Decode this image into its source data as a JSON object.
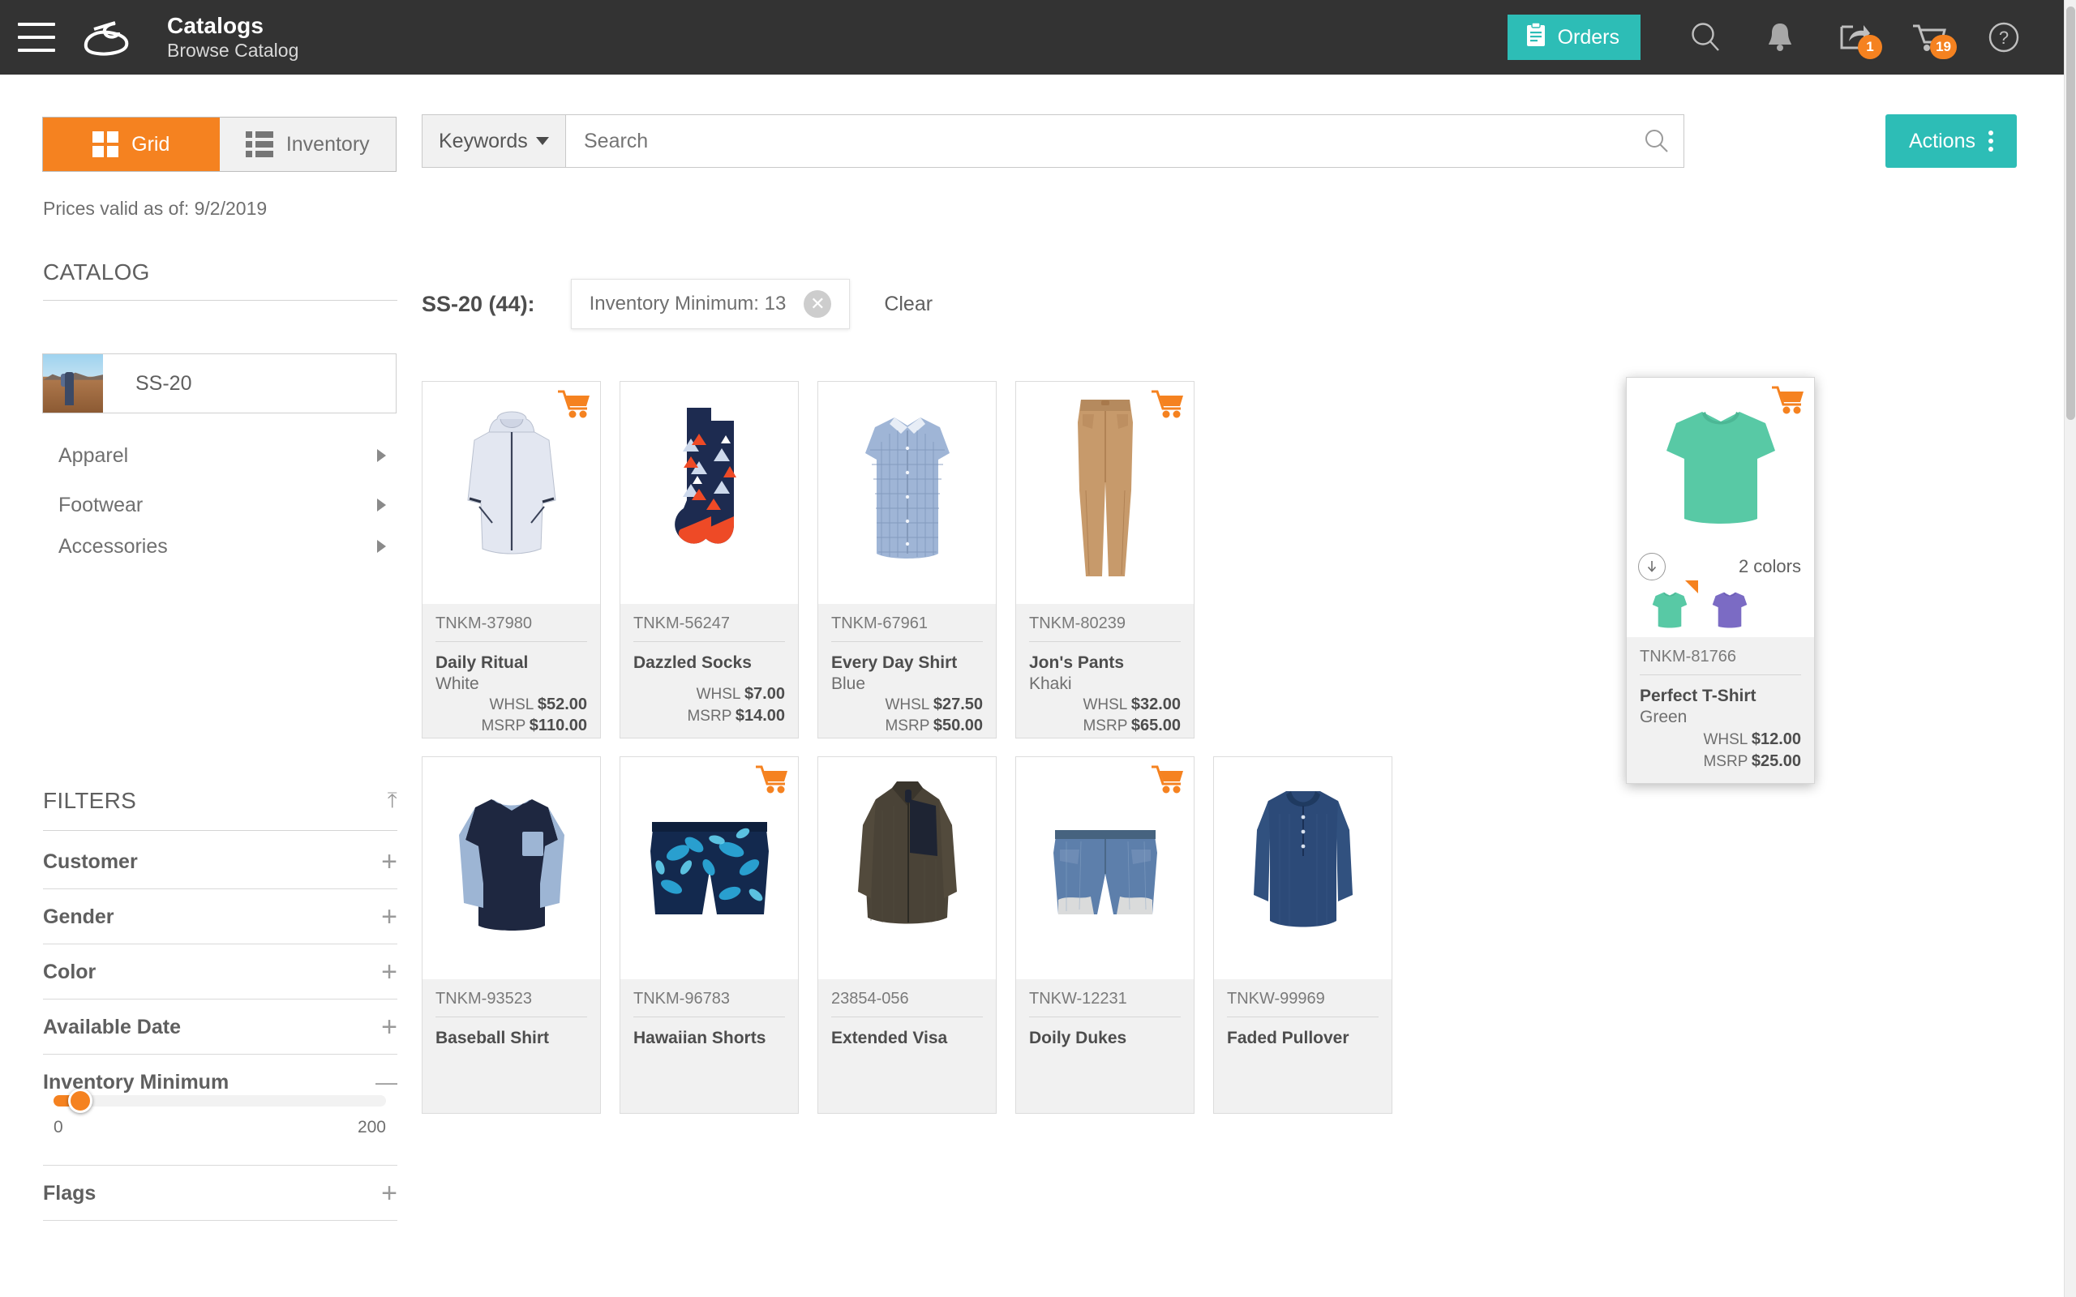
{
  "header": {
    "title": "Catalogs",
    "subtitle": "Browse Catalog",
    "orders_label": "Orders",
    "menu_icon": "hamburger-icon",
    "logo_icon": "brand-logo-icon",
    "search_icon": "search-icon",
    "bell_icon": "notifications-icon",
    "share_icon": "share-icon",
    "cart_icon": "cart-icon",
    "help_icon": "help-icon",
    "share_badge": "1",
    "cart_badge": "19",
    "bar_color": "#333333",
    "accent_teal": "#2dbdb6",
    "accent_orange": "#f58220"
  },
  "sidebar": {
    "view_toggle": {
      "grid_label": "Grid",
      "inventory_label": "Inventory",
      "active": "Grid"
    },
    "prices_valid": "Prices valid as of: 9/2/2019",
    "catalog_heading": "CATALOG",
    "catalog_selected": "SS-20",
    "tree": [
      {
        "label": "Apparel"
      },
      {
        "label": "Footwear"
      },
      {
        "label": "Accessories"
      }
    ],
    "filters_heading": "FILTERS",
    "filters": [
      {
        "label": "Customer",
        "state": "+"
      },
      {
        "label": "Gender",
        "state": "+"
      },
      {
        "label": "Color",
        "state": "+"
      },
      {
        "label": "Available Date",
        "state": "+"
      },
      {
        "label": "Inventory Minimum",
        "state": "—"
      },
      {
        "label": "Flags",
        "state": "+"
      }
    ],
    "slider": {
      "min_label": "0",
      "max_label": "200",
      "value": 13
    }
  },
  "search": {
    "scope_label": "Keywords",
    "placeholder": "Search",
    "value": "",
    "actions_label": "Actions"
  },
  "results": {
    "count_label": "SS-20 (44):",
    "chip_label": "Inventory Minimum: 13",
    "clear_label": "Clear"
  },
  "products": [
    {
      "sku": "TNKM-37980",
      "name": "Daily Ritual",
      "color": "White",
      "whsl_label": "WHSL",
      "whsl": "$52.00",
      "msrp_label": "MSRP",
      "msrp": "$110.00",
      "cart": true,
      "art": "jacket"
    },
    {
      "sku": "TNKM-56247",
      "name": "Dazzled Socks",
      "color": "",
      "whsl_label": "WHSL",
      "whsl": "$7.00",
      "msrp_label": "MSRP",
      "msrp": "$14.00",
      "cart": false,
      "art": "socks"
    },
    {
      "sku": "TNKM-67961",
      "name": "Every Day Shirt",
      "color": "Blue",
      "whsl_label": "WHSL",
      "whsl": "$27.50",
      "msrp_label": "MSRP",
      "msrp": "$50.00",
      "cart": false,
      "art": "shirt"
    },
    {
      "sku": "TNKM-80239",
      "name": "Jon's Pants",
      "color": "Khaki",
      "whsl_label": "WHSL",
      "whsl": "$32.00",
      "msrp_label": "MSRP",
      "msrp": "$65.00",
      "cart": true,
      "art": "pants"
    },
    {
      "sku": "TNKM-81766",
      "name": "Perfect T-Shirt",
      "color": "Green",
      "whsl_label": "WHSL",
      "whsl": "$12.00",
      "msrp_label": "MSRP",
      "msrp": "$25.00",
      "cart": true,
      "art": "tshirt",
      "hovered": true,
      "colors_count": "2 colors",
      "download_icon": "download-icon"
    },
    {
      "sku": "TNKM-93523",
      "name": "Baseball Shirt",
      "color": "",
      "whsl_label": "",
      "whsl": "",
      "msrp_label": "",
      "msrp": "",
      "cart": false,
      "art": "baseball"
    },
    {
      "sku": "TNKM-96783",
      "name": "Hawaiian Shorts",
      "color": "",
      "whsl_label": "",
      "whsl": "",
      "msrp_label": "",
      "msrp": "",
      "cart": true,
      "art": "shorts"
    },
    {
      "sku": "23854-056",
      "name": "Extended Visa",
      "color": "",
      "whsl_label": "",
      "whsl": "",
      "msrp_label": "",
      "msrp": "",
      "cart": false,
      "art": "fleece"
    },
    {
      "sku": "TNKW-12231",
      "name": "Doily Dukes",
      "color": "",
      "whsl_label": "",
      "whsl": "",
      "msrp_label": "",
      "msrp": "",
      "cart": true,
      "art": "denimshorts"
    },
    {
      "sku": "TNKW-99969",
      "name": "Faded Pullover",
      "color": "",
      "whsl_label": "",
      "whsl": "",
      "msrp_label": "",
      "msrp": "",
      "cart": false,
      "art": "pullover"
    }
  ]
}
